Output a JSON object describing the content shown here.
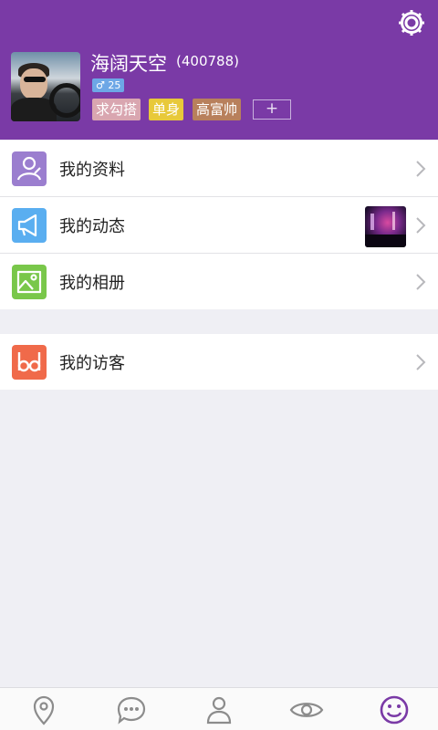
{
  "profile": {
    "name": "海阔天空",
    "uid": "(400788)",
    "gender_age": "♂ 25",
    "tags": [
      "求勾搭",
      "单身",
      "高富帅"
    ],
    "add_tag": "+"
  },
  "menu": {
    "items": [
      {
        "label": "我的资料",
        "icon": "profile-icon",
        "color": "#9b7ecf"
      },
      {
        "label": "我的动态",
        "icon": "megaphone-icon",
        "color": "#5aaef0"
      },
      {
        "label": "我的相册",
        "icon": "photo-icon",
        "color": "#79c74a"
      },
      {
        "label": "我的访客",
        "icon": "visitor-icon",
        "color": "#f06a4a"
      }
    ]
  },
  "tabbar": {
    "items": [
      "location-icon",
      "chat-icon",
      "contacts-icon",
      "discover-icon",
      "me-icon"
    ],
    "active": "me-icon"
  },
  "colors": {
    "header": "#7a3aa6",
    "active_tab": "#7a3aa6",
    "inactive_tab": "#8c8c8c"
  }
}
